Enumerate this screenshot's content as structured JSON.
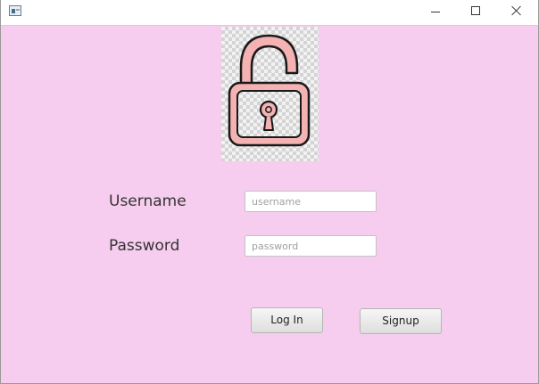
{
  "window": {
    "controls": {
      "minimize_icon": "minimize-icon",
      "maximize_icon": "maximize-icon",
      "close_icon": "close-icon"
    }
  },
  "form": {
    "lock_icon": "padlock-unlocked",
    "username_label": "Username",
    "username_value": "",
    "username_placeholder": "username",
    "password_label": "Password",
    "password_value": "",
    "password_placeholder": "password",
    "login_label": "Log In",
    "signup_label": "Signup"
  },
  "colors": {
    "background": "#f6cdee",
    "lock_outline": "#1a1a1a",
    "lock_tint": "#f4b2b2"
  }
}
